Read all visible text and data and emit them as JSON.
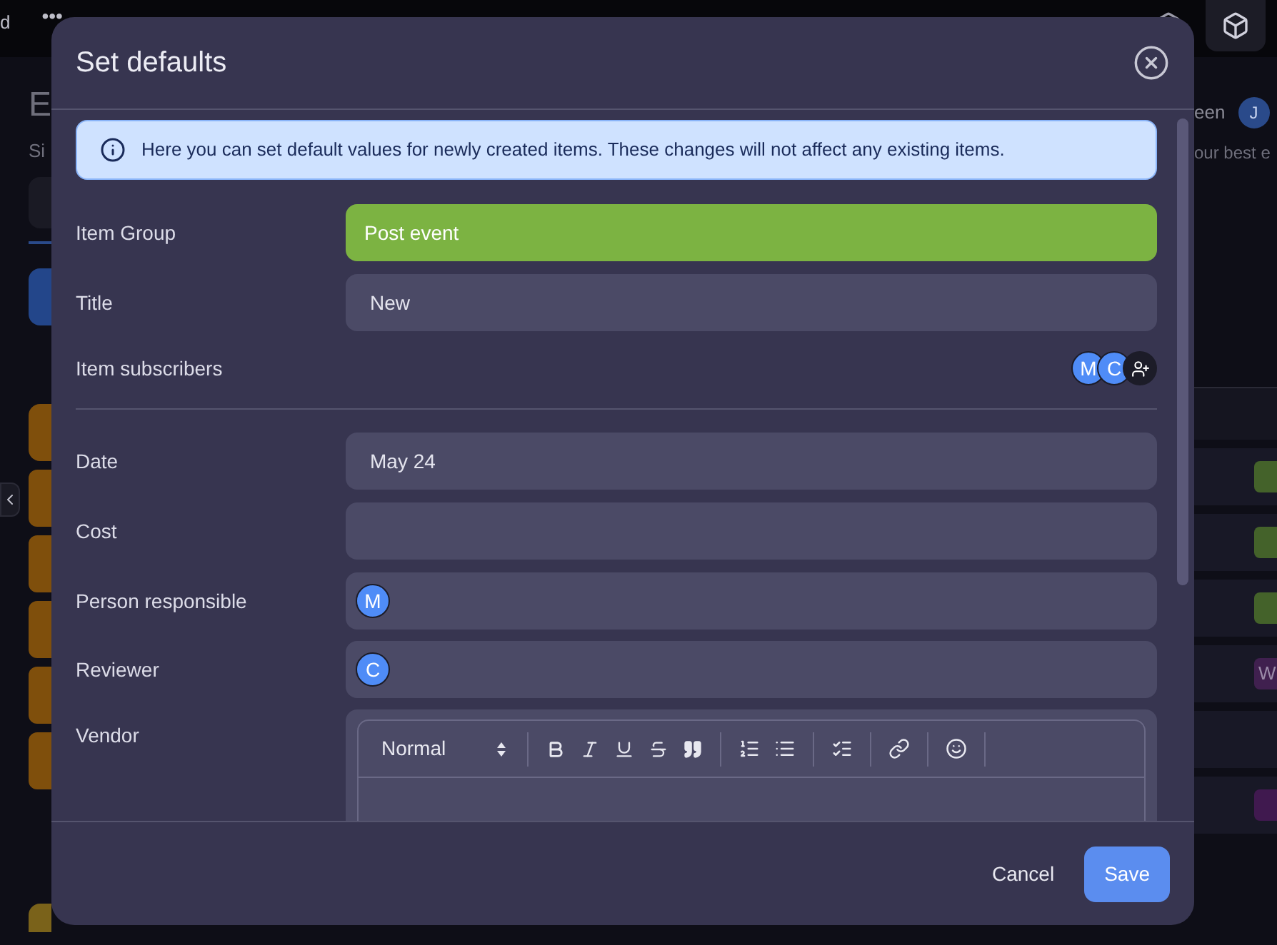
{
  "background": {
    "top_bar": {
      "cut_text": "d",
      "more": "•••"
    },
    "page_title": "E",
    "subtitle": "Si",
    "viewer_text": "een",
    "viewer_avatar": "J",
    "right_text": "our best e",
    "tag_text": "W"
  },
  "dialog": {
    "title": "Set defaults",
    "notice": "Here you can set default values for newly created items. These changes will not affect any existing items.",
    "fields": [
      {
        "kind": "group",
        "label": "Item Group",
        "value": "Post event"
      },
      {
        "kind": "text",
        "label": "Title",
        "value": "New"
      },
      {
        "kind": "subscribers",
        "label": "Item subscribers",
        "avatars": [
          "M",
          "C"
        ]
      },
      {
        "kind": "divider"
      },
      {
        "kind": "text",
        "label": "Date",
        "value": "May 24"
      },
      {
        "kind": "text",
        "label": "Cost"
      },
      {
        "kind": "person",
        "label": "Person responsible",
        "avatars": [
          "M"
        ]
      },
      {
        "kind": "person",
        "label": "Reviewer",
        "avatars": [
          "C"
        ]
      },
      {
        "kind": "rich_text",
        "label": "Vendor",
        "format": "Normal"
      }
    ],
    "buttons": [
      {
        "kind": "text",
        "label": "Cancel"
      },
      {
        "kind": "primary",
        "label": "Save"
      }
    ]
  }
}
